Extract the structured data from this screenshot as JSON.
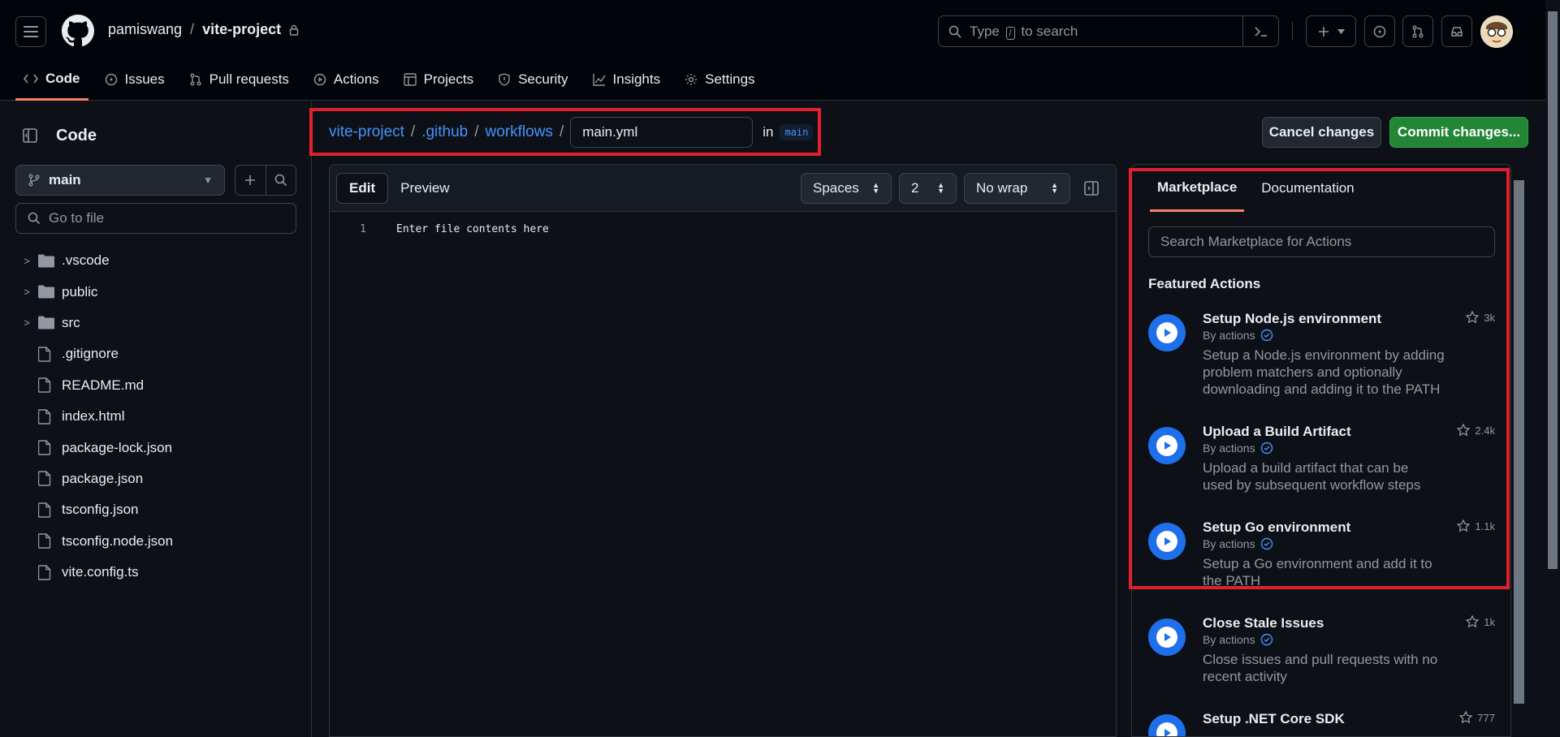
{
  "header": {
    "owner": "pamiswang",
    "separator": "/",
    "repo": "vite-project",
    "search_placeholder": "to search",
    "search_prefix": "Type",
    "search_key": "/"
  },
  "tabs": [
    {
      "label": "Code",
      "icon": "code-icon"
    },
    {
      "label": "Issues",
      "icon": "issue-icon"
    },
    {
      "label": "Pull requests",
      "icon": "pull-request-icon"
    },
    {
      "label": "Actions",
      "icon": "play-icon"
    },
    {
      "label": "Projects",
      "icon": "table-icon"
    },
    {
      "label": "Security",
      "icon": "shield-icon"
    },
    {
      "label": "Insights",
      "icon": "graph-icon"
    },
    {
      "label": "Settings",
      "icon": "gear-icon"
    }
  ],
  "sidebar": {
    "title": "Code",
    "branch": "main",
    "goto_placeholder": "Go to file",
    "items": [
      {
        "name": ".vscode",
        "type": "folder"
      },
      {
        "name": "public",
        "type": "folder"
      },
      {
        "name": "src",
        "type": "folder"
      },
      {
        "name": ".gitignore",
        "type": "file"
      },
      {
        "name": "README.md",
        "type": "file"
      },
      {
        "name": "index.html",
        "type": "file"
      },
      {
        "name": "package-lock.json",
        "type": "file"
      },
      {
        "name": "package.json",
        "type": "file"
      },
      {
        "name": "tsconfig.json",
        "type": "file"
      },
      {
        "name": "tsconfig.node.json",
        "type": "file"
      },
      {
        "name": "vite.config.ts",
        "type": "file"
      }
    ]
  },
  "path": {
    "repo": "vite-project",
    "dir1": ".github",
    "dir2": "workflows",
    "sep": "/",
    "filename": "main.yml",
    "in_label": "in",
    "branch": "main"
  },
  "buttons": {
    "cancel": "Cancel changes",
    "commit": "Commit changes..."
  },
  "editor": {
    "tab_edit": "Edit",
    "tab_preview": "Preview",
    "indent_mode": "Spaces",
    "indent_size": "2",
    "wrap_mode": "No wrap",
    "line_number": "1",
    "placeholder": "Enter file contents here"
  },
  "marketplace": {
    "tab_marketplace": "Marketplace",
    "tab_documentation": "Documentation",
    "search_placeholder": "Search Marketplace for Actions",
    "featured_heading": "Featured Actions",
    "actions": [
      {
        "title": "Setup Node.js environment",
        "by": "By actions",
        "desc": "Setup a Node.js environment by adding problem matchers and optionally downloading and adding it to the PATH",
        "stars": "3k"
      },
      {
        "title": "Upload a Build Artifact",
        "by": "By actions",
        "desc": "Upload a build artifact that can be used by subsequent workflow steps",
        "stars": "2.4k"
      },
      {
        "title": "Setup Go environment",
        "by": "By actions",
        "desc": "Setup a Go environment and add it to the PATH",
        "stars": "1.1k"
      },
      {
        "title": "Close Stale Issues",
        "by": "By actions",
        "desc": "Close issues and pull requests with no recent activity",
        "stars": "1k"
      },
      {
        "title": "Setup .NET Core SDK",
        "by": "By actions",
        "desc": "",
        "stars": "777"
      }
    ]
  },
  "colors": {
    "accent_link": "#4493f8",
    "commit_green": "#238636",
    "tab_underline": "#f78166",
    "highlight_red": "#e0202c",
    "play_blue": "#1f6feb"
  }
}
